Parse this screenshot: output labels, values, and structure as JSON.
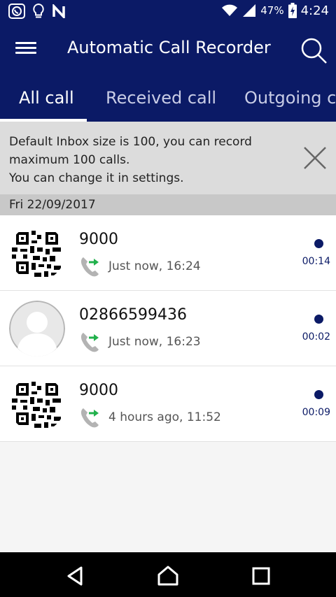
{
  "status_bar": {
    "battery_percent": "47%",
    "time": "4:24"
  },
  "app_bar": {
    "title": "Automatic Call Recorder"
  },
  "tabs": [
    {
      "label": "All call",
      "active": true
    },
    {
      "label": "Received call",
      "active": false
    },
    {
      "label": "Outgoing ca",
      "active": false
    }
  ],
  "banner": {
    "line1": "Default Inbox size is 100, you can record maximum 100 calls.",
    "line2": "You can change it in settings."
  },
  "date_header": "Fri 22/09/2017",
  "calls": [
    {
      "number": "9000",
      "when": "Just now, 16:24",
      "duration": "00:14",
      "avatar": "qr-code-avatar",
      "direction": "outgoing"
    },
    {
      "number": "02866599436",
      "when": "Just now, 16:23",
      "duration": "00:02",
      "avatar": "default-person-avatar",
      "direction": "outgoing"
    },
    {
      "number": "9000",
      "when": "4 hours ago, 11:52",
      "duration": "00:09",
      "avatar": "qr-code-avatar",
      "direction": "outgoing"
    }
  ],
  "colors": {
    "primary": "#0b1a66",
    "banner_bg": "#dcdcdc",
    "date_bg": "#c8c8c8",
    "arrow_green": "#22b14c"
  }
}
